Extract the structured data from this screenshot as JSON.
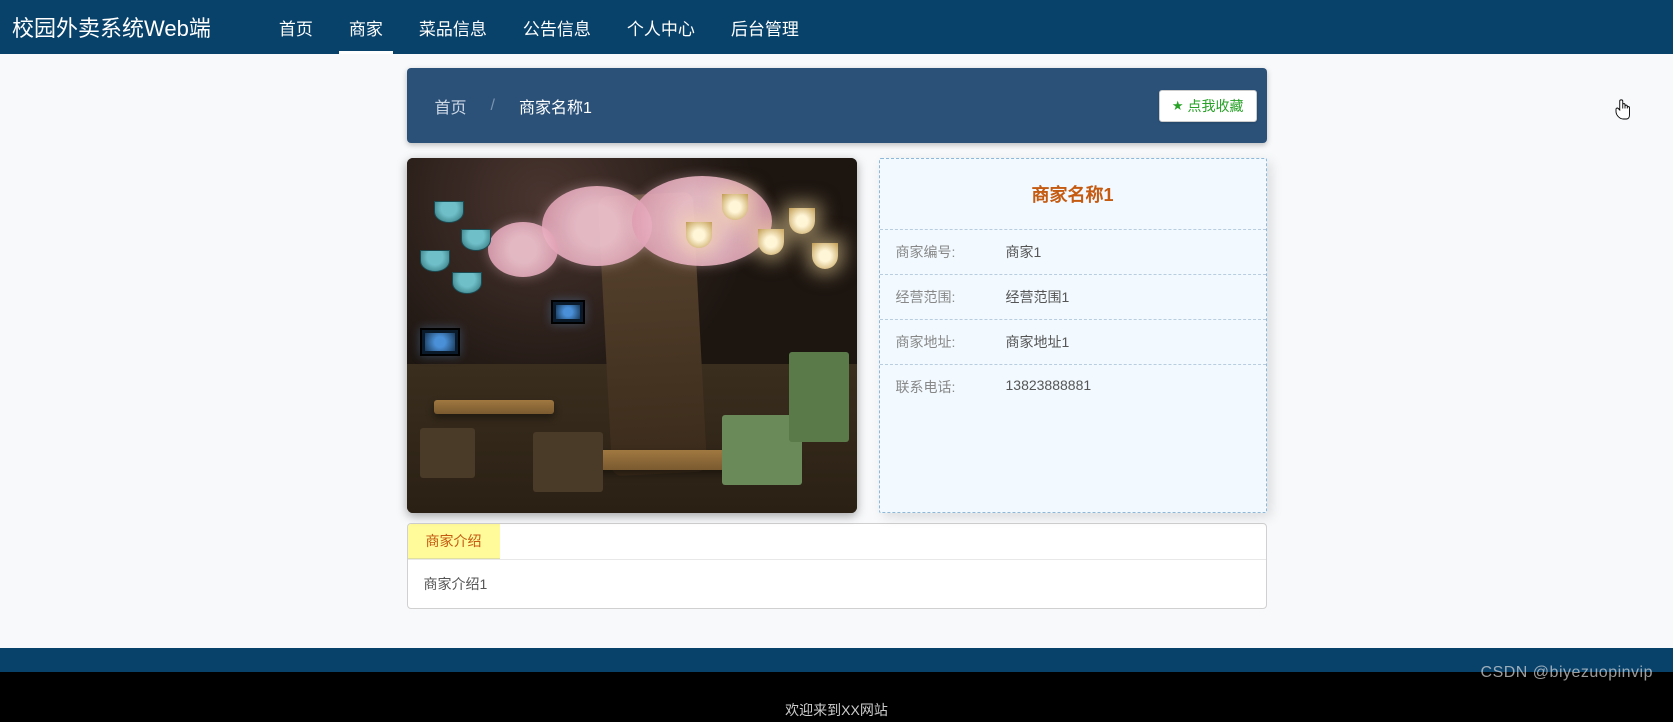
{
  "brand": "校园外卖系统Web端",
  "nav": [
    {
      "label": "首页",
      "active": false
    },
    {
      "label": "商家",
      "active": true
    },
    {
      "label": "菜品信息",
      "active": false
    },
    {
      "label": "公告信息",
      "active": false
    },
    {
      "label": "个人中心",
      "active": false
    },
    {
      "label": "后台管理",
      "active": false
    }
  ],
  "breadcrumb": {
    "home": "首页",
    "separator": "/",
    "current": "商家名称1"
  },
  "favorite_button": "点我收藏",
  "detail": {
    "title": "商家名称1",
    "fields": [
      {
        "label": "商家编号:",
        "value": "商家1"
      },
      {
        "label": "经营范围:",
        "value": "经营范围1"
      },
      {
        "label": "商家地址:",
        "value": "商家地址1"
      },
      {
        "label": "联系电话:",
        "value": "13823888881"
      }
    ]
  },
  "intro": {
    "tab": "商家介绍",
    "content": "商家介绍1"
  },
  "footer_text": "欢迎来到XX网站",
  "watermark": "CSDN @biyezuopinvip"
}
